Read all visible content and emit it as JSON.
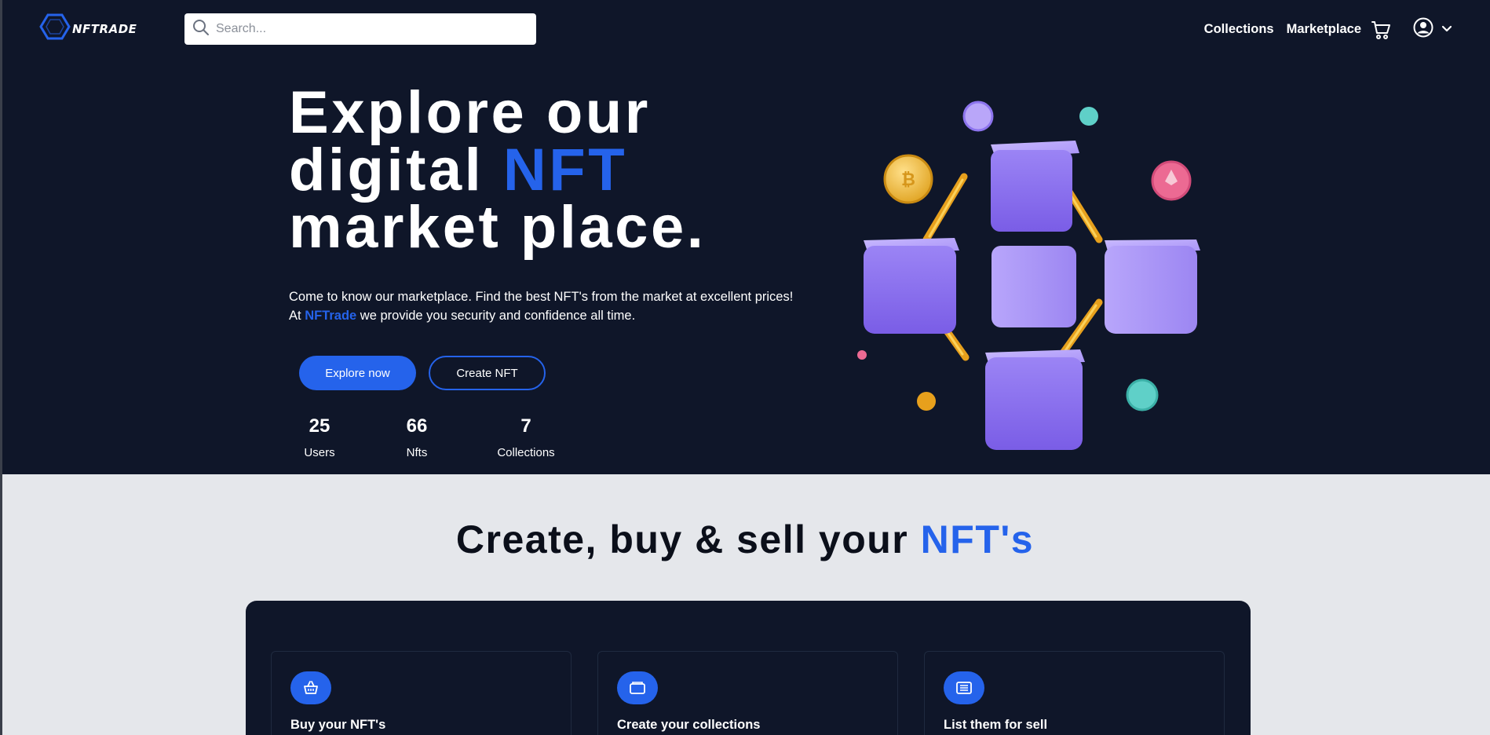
{
  "navbar": {
    "logo_text": "NFTRADE",
    "search_placeholder": "Search...",
    "links": {
      "collections": "Collections",
      "marketplace": "Marketplace"
    }
  },
  "hero": {
    "title_line1": "Explore our",
    "title_line2_prefix": "digital ",
    "title_line2_accent": "NFT",
    "title_line3": "market place.",
    "desc_line1": "Come to know our marketplace. Find the best NFT's from the market at excellent prices!",
    "desc_line2_prefix": "At ",
    "desc_brand": "NFTrade",
    "desc_line2_suffix": " we provide you security and confidence all time.",
    "explore_button": "Explore now",
    "create_button": "Create NFT",
    "stats": [
      {
        "value": "25",
        "label": "Users"
      },
      {
        "value": "66",
        "label": "Nfts"
      },
      {
        "value": "7",
        "label": "Collections"
      }
    ]
  },
  "features": {
    "title_prefix": "Create, buy & sell your ",
    "title_accent": "NFT's",
    "cards": [
      {
        "title": "Buy your NFT's",
        "icon": "basket-icon"
      },
      {
        "title": "Create your collections",
        "icon": "wallet-icon"
      },
      {
        "title": "List them for sell",
        "icon": "list-icon"
      }
    ]
  },
  "colors": {
    "background": "#0f1629",
    "accent": "#2563eb",
    "light_section": "#e5e7eb"
  }
}
